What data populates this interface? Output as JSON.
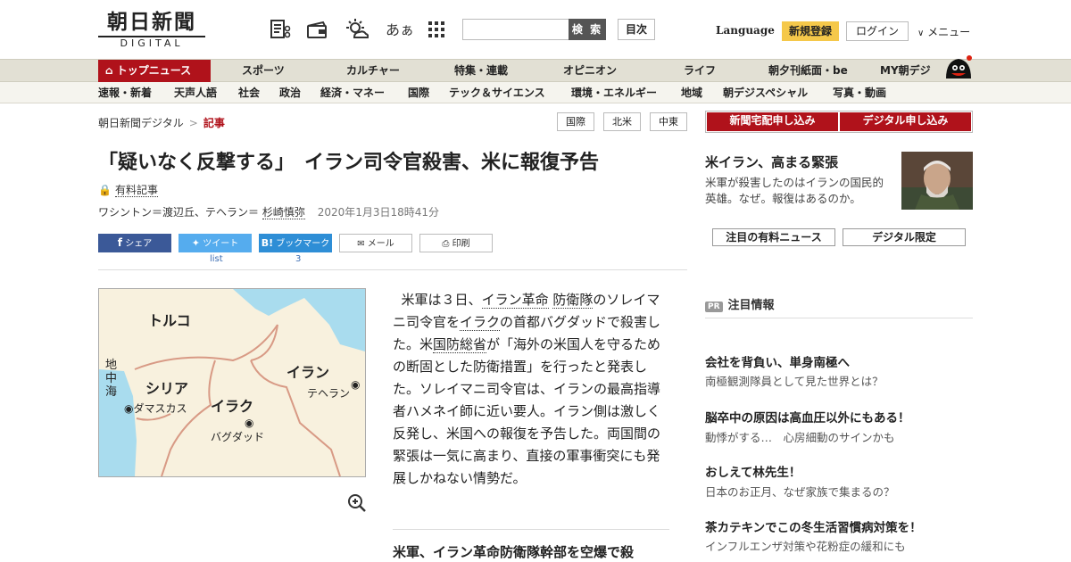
{
  "header": {
    "logo_main": "朝日新聞",
    "logo_sub": "DIGITAL",
    "icons": [
      "newspaper-scissors-icon",
      "wallet-icon",
      "weather-icon",
      "font-size-icon",
      "grid-menu-icon"
    ],
    "font_size_label": "あぁ",
    "search_placeholder": "",
    "search_button": "検 索",
    "toc_button": "目次",
    "language": "Language",
    "register": "新規登録",
    "login": "ログイン",
    "menu": "メニュー"
  },
  "nav_primary": [
    "トップニュース",
    "スポーツ",
    "カルチャー",
    "特集・連載",
    "オピニオン",
    "ライフ",
    "朝夕刊紙面・be",
    "MY朝デジ"
  ],
  "nav_secondary": [
    "速報・新着",
    "天声人語",
    "社会",
    "政治",
    "経済・マネー",
    "国際",
    "テック＆サイエンス",
    "環境・エネルギー",
    "地域",
    "朝デジスペシャル",
    "写真・動画"
  ],
  "breadcrumb": {
    "home": "朝日新聞デジタル",
    "separator": ">",
    "current": "記事"
  },
  "tags": [
    "国際",
    "北米",
    "中東"
  ],
  "article": {
    "title": "「疑いなく反撃する」　イラン司令官殺害、米に報復予告",
    "paid_label": "有料記事",
    "byline_prefix": "ワシントン＝渡辺丘、テヘラン＝",
    "byline_name": "杉崎慎弥",
    "date": "2020年1月3日18時41分",
    "share": {
      "facebook": "シェア",
      "twitter": "ツイート",
      "twitter_count": "list",
      "hatena": "ブックマーク",
      "hatena_count": "3",
      "mail": "メール",
      "print": "印刷"
    },
    "map_labels": {
      "turkey": "トルコ",
      "syria": "シリア",
      "iraq": "イラク",
      "iran": "イラン",
      "mediterranean": "地中海",
      "damascus": "ダマスカス",
      "baghdad": "バグダッド",
      "tehran": "テヘラン"
    },
    "body": {
      "p1": "米軍は３日、",
      "link1": "イラン革命",
      "link2": "防衛隊",
      "p2": "のソレイマニ司令官を",
      "link3": "イラク",
      "p3": "の首都バグダッドで殺害した。米",
      "link4": "国防総省",
      "p4": "が「海外の米国人を守るための断固とした防衛措置」を行ったと発表した。ソレイマニ司令官は、イランの最高指導者ハメネイ師に近い要人。イラン側は激しく反発し、米国への報復を予告した。両国間の緊張は一気に高まり、直接の軍事衝突にも発展しかねない情勢だ。"
    },
    "related": "米軍、イラン革命防衛隊幹部を空爆で殺"
  },
  "sidebar": {
    "subscribe_paper": "新聞宅配申し込み",
    "subscribe_digital": "デジタル申し込み",
    "feature_title": "米イラン、高まる緊張",
    "feature_desc": "米軍が殺害したのはイランの国民的英雄。なぜ。報復はあるのか。",
    "btn_paid_news": "注目の有料ニュース",
    "btn_digital_only": "デジタル限定",
    "pr_badge": "PR",
    "pr_title": "注目情報",
    "pr_items": [
      {
        "title": "会社を背負い、単身南極へ",
        "desc": "南極観測隊員として見た世界とは？"
      },
      {
        "title": "脳卒中の原因は高血圧以外にもある！",
        "desc": "動悸がする…　心房細動のサインかも"
      },
      {
        "title": "おしえて林先生！",
        "desc": "日本のお正月、なぜ家族で集まるの？"
      },
      {
        "title": "茶カテキンでこの冬生活習慣病対策を！",
        "desc": "インフルエンザ対策や花粉症の緩和にも"
      }
    ]
  },
  "colors": {
    "brand_red": "#b0121b",
    "register_yellow": "#f5c84a",
    "facebook": "#3b5998",
    "twitter": "#55acee",
    "hatena": "#2e8ed6"
  }
}
